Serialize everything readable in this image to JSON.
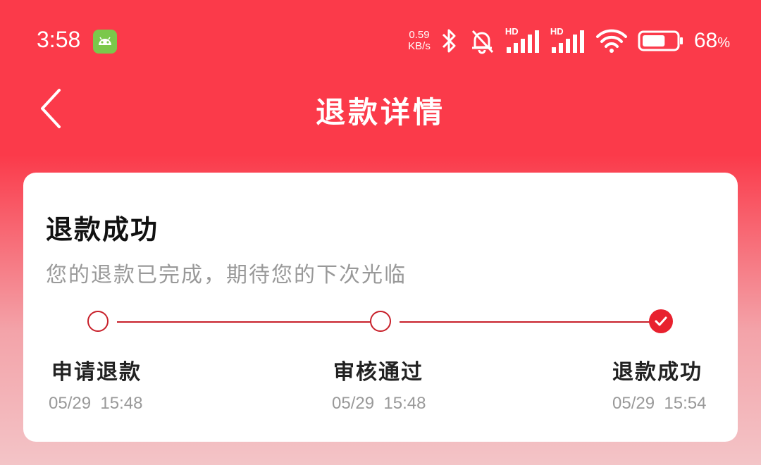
{
  "status_bar": {
    "time": "3:58",
    "net_speed_value": "0.59",
    "net_speed_unit": "KB/s",
    "hd1": "HD",
    "hd2": "HD",
    "battery_percent": "68",
    "battery_unit": "%",
    "battery_level": 0.68
  },
  "header": {
    "title": "退款详情"
  },
  "card": {
    "title": "退款成功",
    "subtitle": "您的退款已完成，期待您的下次光临",
    "steps": [
      {
        "label": "申请退款",
        "time": "05/29  15:48",
        "state": "outline"
      },
      {
        "label": "审核通过",
        "time": "05/29  15:48",
        "state": "outline"
      },
      {
        "label": "退款成功",
        "time": "05/29  15:54",
        "state": "done"
      }
    ]
  },
  "colors": {
    "primary_red": "#fb3a4a",
    "progress_red": "#c8202a",
    "check_red": "#e8212e"
  }
}
